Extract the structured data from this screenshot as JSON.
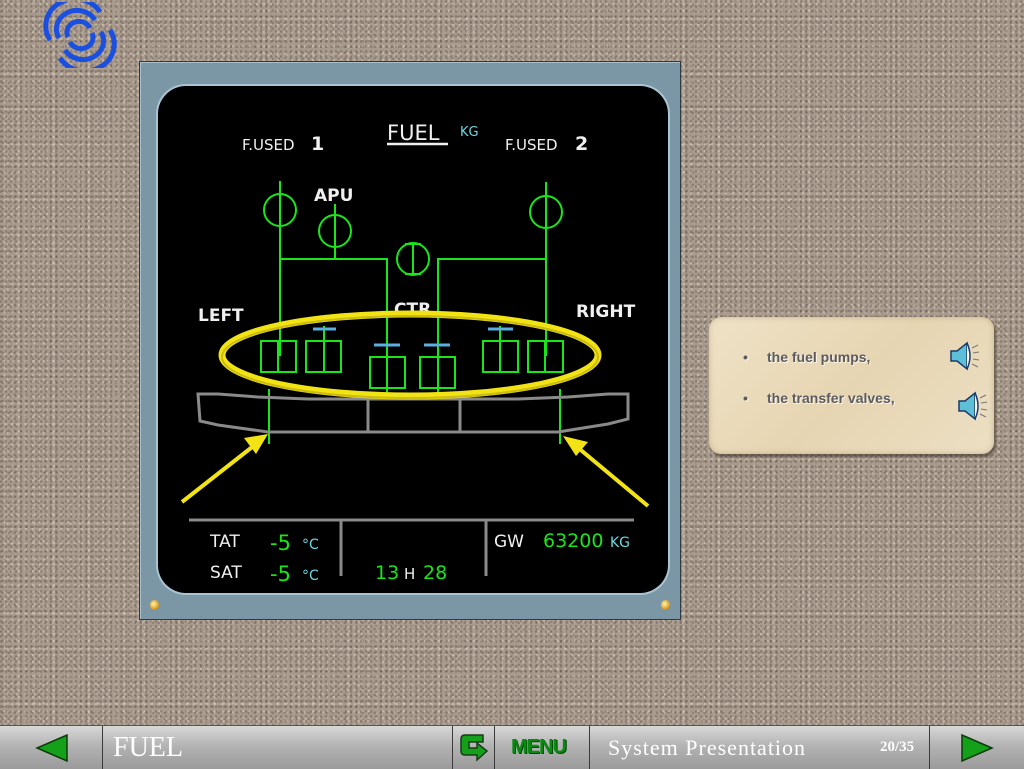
{
  "logo": {
    "icon": "company-swirl-logo",
    "color": "#1a4fe0"
  },
  "ecam": {
    "title": "FUEL",
    "title_unit": "KG",
    "fused_1_label": "F.USED",
    "fused_1_num": "1",
    "fused_2_label": "F.USED",
    "fused_2_num": "2",
    "apu_label": "APU",
    "left_label": "LEFT",
    "ctr_label": "CTR",
    "right_label": "RIGHT",
    "tat_label": "TAT",
    "tat_value": "-5",
    "tat_unit": "°C",
    "sat_label": "SAT",
    "sat_value": "-5",
    "sat_unit": "°C",
    "time_hours": "13",
    "time_sep": "H",
    "time_minutes": "28",
    "gw_label": "GW",
    "gw_value": "63200",
    "gw_unit": "KG",
    "colors": {
      "green": "#19e619",
      "cyan": "#6fd6e0",
      "white": "#f0f0f0",
      "grey": "#8a8a8a",
      "blue_bar": "#5aaee0",
      "highlight": "#f2e414"
    }
  },
  "notes": {
    "items": [
      {
        "bullet": "•",
        "text": "the fuel pumps,",
        "icon": "speaker-icon"
      },
      {
        "bullet": "•",
        "text": "the transfer valves,",
        "icon": "speaker-icon"
      }
    ]
  },
  "navbar": {
    "prev_icon": "triangle-left-icon",
    "section_title": "FUEL",
    "return_icon": "return-arrow-icon",
    "menu_label": "MENU",
    "presentation_title": "System Presentation",
    "page_indicator": "20/35",
    "next_icon": "triangle-right-icon"
  }
}
